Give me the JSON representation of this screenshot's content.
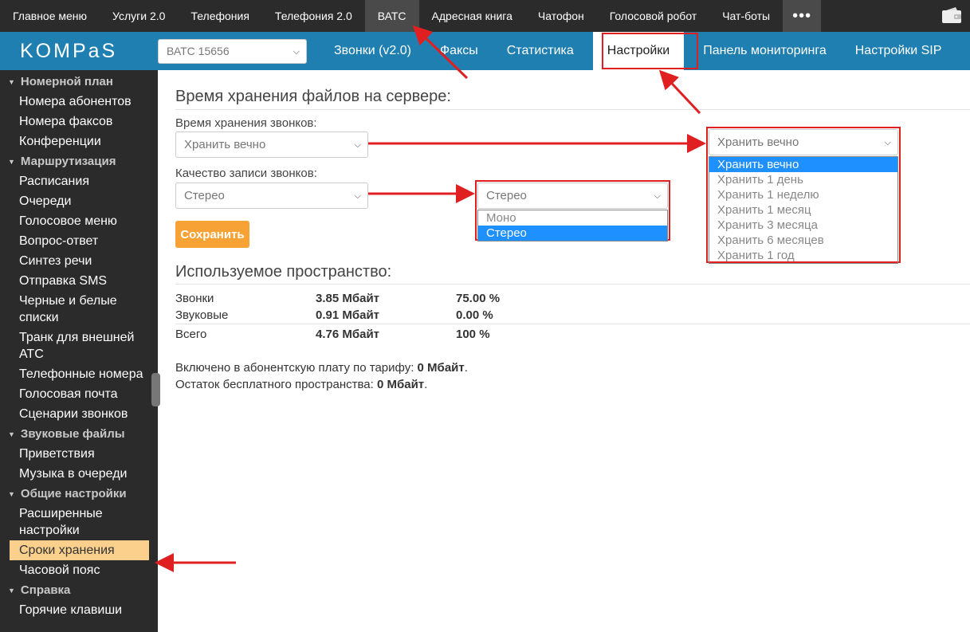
{
  "topnav": {
    "items": [
      "Главное меню",
      "Услуги 2.0",
      "Телефония",
      "Телефония 2.0",
      "ВАТС",
      "Адресная книга",
      "Чатофон",
      "Голосовой робот",
      "Чат-боты"
    ],
    "more": "•••",
    "active_index": 4
  },
  "logo": "KOMPaS",
  "pbx_select": {
    "value": "ВАТС 15656"
  },
  "subnav": {
    "items": [
      "Звонки (v2.0)",
      "Факсы",
      "Статистика",
      "Настройки",
      "Панель мониторинга",
      "Настройки SIP"
    ],
    "active_index": 3
  },
  "sidebar": {
    "sections": [
      {
        "title": "Номерной план",
        "items": [
          "Номера абонентов",
          "Номера факсов",
          "Конференции"
        ]
      },
      {
        "title": "Маршрутизация",
        "items": [
          "Расписания",
          "Очереди",
          "Голосовое меню",
          "Вопрос-ответ",
          "Синтез речи",
          "Отправка SMS",
          "Черные и белые списки",
          "Транк для внешней АТС",
          "Телефонные номера",
          "Голосовая почта",
          "Сценарии звонков"
        ]
      },
      {
        "title": "Звуковые файлы",
        "items": [
          "Приветствия",
          "Музыка в очереди"
        ]
      },
      {
        "title": "Общие настройки",
        "items": [
          "Расширенные настройки",
          "Сроки хранения",
          "Часовой пояс"
        ]
      },
      {
        "title": "Справка",
        "items": [
          "Горячие клавиши"
        ]
      }
    ],
    "active_item": "Сроки хранения"
  },
  "main": {
    "storage_title": "Время хранения файлов на сервере:",
    "calls_storage_label": "Время хранения звонков:",
    "calls_storage_value": "Хранить вечно",
    "quality_label": "Качество записи звонков:",
    "quality_value": "Стерео",
    "save_label": "Сохранить",
    "usage_title": "Используемое пространство:",
    "usage_rows": [
      {
        "name": "Звонки",
        "size": "3.85 Мбайт",
        "percent": "75.00 %"
      },
      {
        "name": "Звуковые",
        "size": "0.91 Мбайт",
        "percent": "0.00 %"
      }
    ],
    "usage_total": {
      "name": "Всего",
      "size": "4.76 Мбайт",
      "percent": "100 %"
    },
    "included_label": "Включено в абонентскую плату по тарифу:",
    "included_value": "0 Мбайт",
    "remaining_label": "Остаток бесплатного пространства:",
    "remaining_value": "0 Мбайт"
  },
  "storage_dropdown": {
    "value": "Хранить вечно",
    "options": [
      "Хранить вечно",
      "Хранить 1 день",
      "Хранить 1 неделю",
      "Хранить 1 месяц",
      "Хранить 3 месяца",
      "Хранить 6 месяцев",
      "Хранить 1 год"
    ],
    "selected_index": 0
  },
  "quality_dropdown": {
    "value": "Стерео",
    "options": [
      "Моно",
      "Стерео"
    ],
    "selected_index": 1
  },
  "colors": {
    "topbar": "#2b2b2b",
    "brand_blue": "#1f7fb0",
    "save_orange": "#f7a234",
    "active_item": "#fbd08d",
    "annotation_red": "#e02020",
    "option_highlight": "#1e90ff"
  }
}
